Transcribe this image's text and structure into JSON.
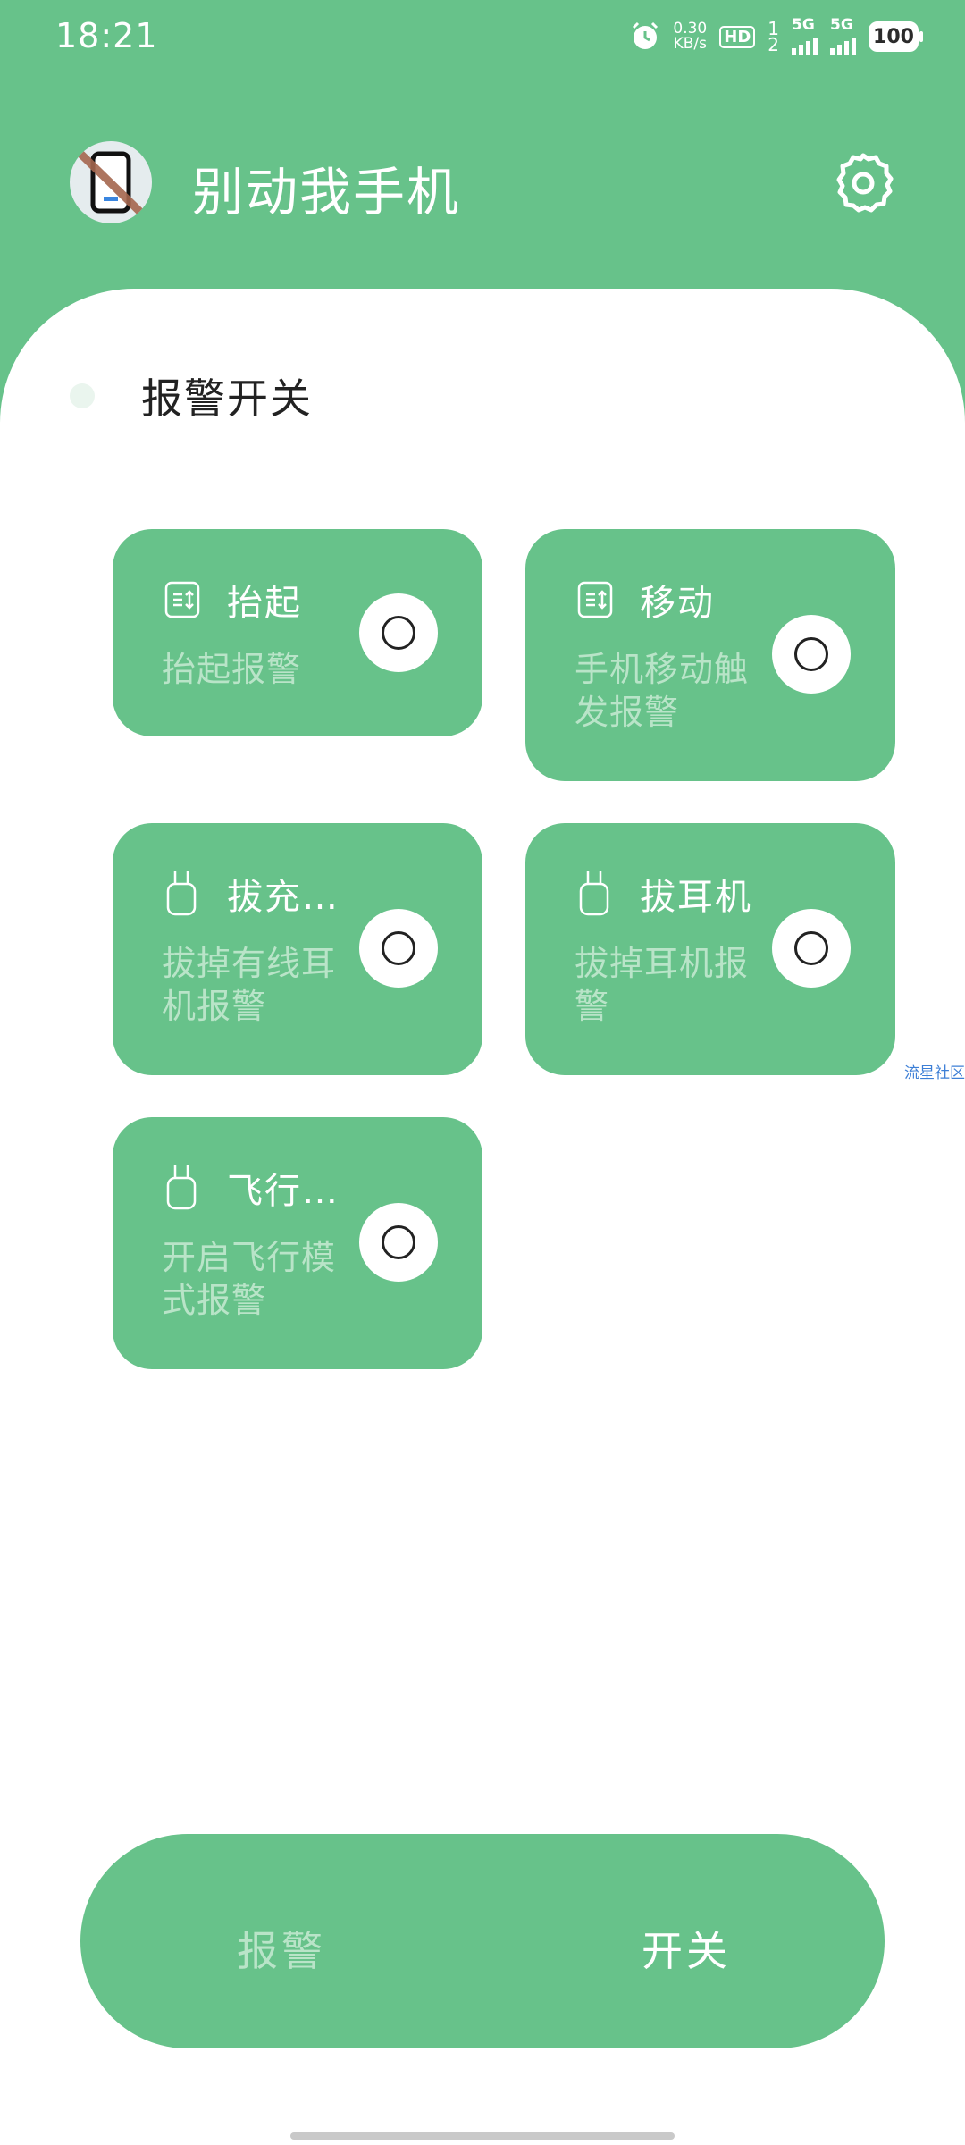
{
  "status_bar": {
    "time": "18:21",
    "net_speed_value": "0.30",
    "net_speed_unit": "KB/s",
    "hd_label": "HD",
    "sim_top": "1",
    "sim_bottom": "2",
    "network_1": "5G",
    "network_2": "5G",
    "battery": "100"
  },
  "header": {
    "app_title": "别动我手机"
  },
  "alarm_toggle": {
    "label": "报警开关"
  },
  "cards": [
    {
      "title": "抬起",
      "desc": "抬起报警",
      "icon": "list-sort-icon"
    },
    {
      "title": "移动",
      "desc": "手机移动触发报警",
      "icon": "list-sort-icon"
    },
    {
      "title": "拔充…",
      "desc": "拔掉有线耳机报警",
      "icon": "plug-icon"
    },
    {
      "title": "拔耳机",
      "desc": "拔掉耳机报警",
      "icon": "plug-icon"
    },
    {
      "title": "飞行…",
      "desc": "开启飞行模式报警",
      "icon": "plug-icon"
    }
  ],
  "watermark": "流星社区",
  "bottom_nav": {
    "alarm_label": "报警",
    "switch_label": "开关"
  },
  "colors": {
    "accent": "#67C28A",
    "desc_text": "#B9E4C8",
    "panel": "#FFFFFF"
  }
}
